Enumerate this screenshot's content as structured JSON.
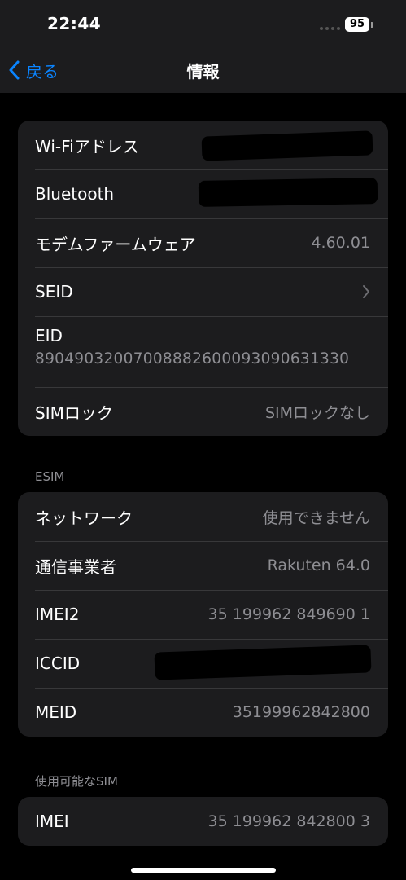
{
  "status_bar": {
    "time": "22:44",
    "battery": "95"
  },
  "nav": {
    "back_label": "戻る",
    "title": "情報"
  },
  "device_group": {
    "wifi_label": "Wi-Fiアドレス",
    "bluetooth_label": "Bluetooth",
    "modem_label": "モデムファームウェア",
    "modem_value": "4.60.01",
    "seid_label": "SEID",
    "eid_label": "EID",
    "eid_value": "89049032007008882600093090631330",
    "simlock_label": "SIMロック",
    "simlock_value": "SIMロックなし"
  },
  "esim_section": {
    "title": "ESIM",
    "network_label": "ネットワーク",
    "network_value": "使用できません",
    "carrier_label": "通信事業者",
    "carrier_value": "Rakuten 64.0",
    "imei2_label": "IMEI2",
    "imei2_value": "35 199962 849690 1",
    "iccid_label": "ICCID",
    "meid_label": "MEID",
    "meid_value": "35199962842800"
  },
  "available_sim_section": {
    "title": "使用可能なSIM",
    "imei_label": "IMEI",
    "imei_value": "35 199962 842800 3"
  },
  "colors": {
    "accent": "#0a84ff",
    "cell": "#1c1c1e",
    "secondary_text": "#8e8e93"
  }
}
